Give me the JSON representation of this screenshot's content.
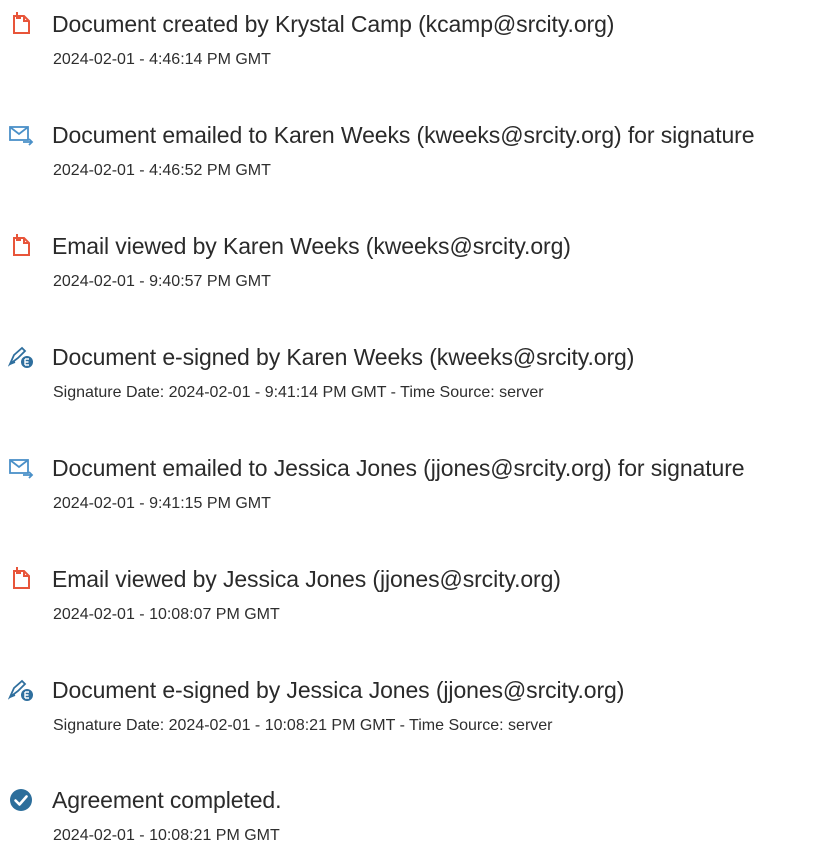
{
  "colors": {
    "document_icon": "#e8553a",
    "email_icon": "#4a90c8",
    "esign_icon": "#2f6f9e",
    "complete_icon": "#2c6e9b",
    "text": "#2a2a2a"
  },
  "events": [
    {
      "icon": "document-icon",
      "title": "Document created by Krystal Camp (kcamp@srcity.org)",
      "meta": "2024-02-01 - 4:46:14 PM GMT"
    },
    {
      "icon": "email-send-icon",
      "title": "Document emailed to Karen Weeks (kweeks@srcity.org) for signature",
      "meta": "2024-02-01 - 4:46:52 PM GMT"
    },
    {
      "icon": "document-icon",
      "title": "Email viewed by Karen Weeks (kweeks@srcity.org)",
      "meta": "2024-02-01 - 9:40:57 PM GMT"
    },
    {
      "icon": "esign-pen-icon",
      "title": "Document e-signed by Karen Weeks (kweeks@srcity.org)",
      "meta": "Signature Date: 2024-02-01 - 9:41:14 PM GMT - Time Source: server"
    },
    {
      "icon": "email-send-icon",
      "title": "Document emailed to Jessica Jones (jjones@srcity.org) for signature",
      "meta": "2024-02-01 - 9:41:15 PM GMT"
    },
    {
      "icon": "document-icon",
      "title": "Email viewed by Jessica Jones (jjones@srcity.org)",
      "meta": "2024-02-01 - 10:08:07 PM GMT"
    },
    {
      "icon": "esign-pen-icon",
      "title": "Document e-signed by Jessica Jones (jjones@srcity.org)",
      "meta": "Signature Date: 2024-02-01 - 10:08:21 PM GMT - Time Source: server"
    },
    {
      "icon": "check-circle-icon",
      "title": "Agreement completed.",
      "meta": "2024-02-01 - 10:08:21 PM GMT"
    }
  ]
}
